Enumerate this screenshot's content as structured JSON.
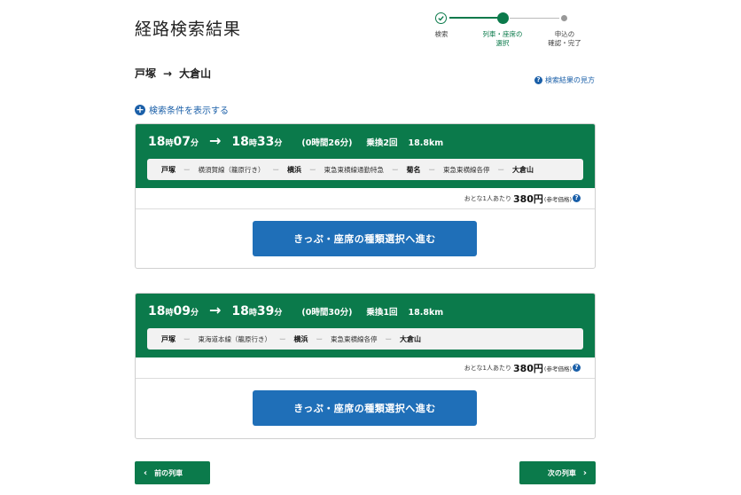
{
  "page_title": "経路検索結果",
  "stepper": {
    "steps": [
      {
        "label": "検索"
      },
      {
        "label": "列車・座席の\n選択"
      },
      {
        "label": "申込の\n確認・完了"
      }
    ]
  },
  "route": {
    "from": "戸塚",
    "arrow": "→",
    "to": "大倉山"
  },
  "help_link": "検索結果の見方",
  "help_icon_glyph": "?",
  "condition_link": "検索条件を表示する",
  "plus_glyph": "+",
  "results": [
    {
      "dep_hour": "18",
      "dep_min": "07",
      "arr_hour": "18",
      "arr_min": "33",
      "hour_unit": "時",
      "min_unit": "分",
      "arrow": "→",
      "duration": "(0時間26分)",
      "transfers": "乗換2回",
      "distance": "18.8km",
      "segments": [
        {
          "text": "戸塚",
          "type": "station"
        },
        {
          "text": "横須賀線（籠原行き）",
          "type": "line"
        },
        {
          "text": "横浜",
          "type": "station"
        },
        {
          "text": "東急東横線通勤特急",
          "type": "line"
        },
        {
          "text": "菊名",
          "type": "station"
        },
        {
          "text": "東急東横線各停",
          "type": "line"
        },
        {
          "text": "大倉山",
          "type": "station"
        }
      ],
      "price_label": "おとな1人あたり",
      "price_value": "380円",
      "price_note": "(参考価格)",
      "button_label": "きっぷ・座席の種類選択へ進む"
    },
    {
      "dep_hour": "18",
      "dep_min": "09",
      "arr_hour": "18",
      "arr_min": "39",
      "hour_unit": "時",
      "min_unit": "分",
      "arrow": "→",
      "duration": "(0時間30分)",
      "transfers": "乗換1回",
      "distance": "18.8km",
      "segments": [
        {
          "text": "戸塚",
          "type": "station"
        },
        {
          "text": "東海道本線（籠原行き）",
          "type": "line"
        },
        {
          "text": "横浜",
          "type": "station"
        },
        {
          "text": "東急東横線各停",
          "type": "line"
        },
        {
          "text": "大倉山",
          "type": "station"
        }
      ],
      "price_label": "おとな1人あたり",
      "price_value": "380円",
      "price_note": "(参考価格)",
      "button_label": "きっぷ・座席の種類選択へ進む"
    }
  ],
  "segment_separator": "ー",
  "nav": {
    "prev_label": "前の列車",
    "prev_glyph": "‹",
    "next_label": "次の列車",
    "next_glyph": "›"
  },
  "colors": {
    "brand_green": "#0b7a4b",
    "button_blue": "#1f6fb8",
    "link_blue": "#1a5fa8"
  }
}
